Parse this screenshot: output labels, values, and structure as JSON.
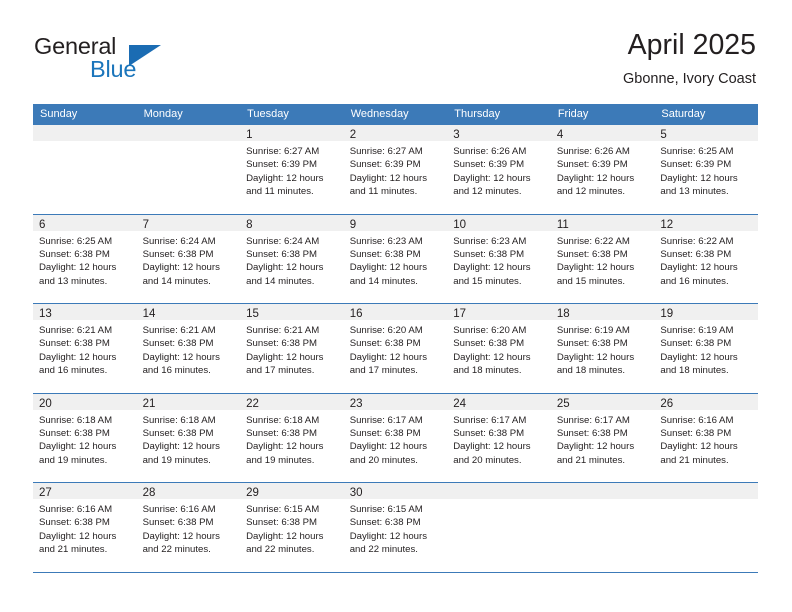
{
  "brand": {
    "name_top": "General",
    "name_bottom": "Blue",
    "triangle_color": "#1b6cb3",
    "blue_color": "#1b75bb"
  },
  "header": {
    "title": "April 2025",
    "subtitle": "Gbonne, Ivory Coast"
  },
  "theme": {
    "header_blue": "#3c7ab8",
    "daynum_band": "#f0f0f0",
    "text": "#231f20"
  },
  "weekdays": [
    "Sunday",
    "Monday",
    "Tuesday",
    "Wednesday",
    "Thursday",
    "Friday",
    "Saturday"
  ],
  "labels": {
    "sunrise_prefix": "Sunrise:",
    "sunset_prefix": "Sunset:",
    "daylight_prefix": "Daylight:"
  },
  "weeks": [
    [
      {
        "day": "",
        "sunrise": "",
        "sunset": "",
        "daylight_line1": "",
        "daylight_line2": ""
      },
      {
        "day": "",
        "sunrise": "",
        "sunset": "",
        "daylight_line1": "",
        "daylight_line2": ""
      },
      {
        "day": "1",
        "sunrise": "Sunrise: 6:27 AM",
        "sunset": "Sunset: 6:39 PM",
        "daylight_line1": "Daylight: 12 hours",
        "daylight_line2": "and 11 minutes."
      },
      {
        "day": "2",
        "sunrise": "Sunrise: 6:27 AM",
        "sunset": "Sunset: 6:39 PM",
        "daylight_line1": "Daylight: 12 hours",
        "daylight_line2": "and 11 minutes."
      },
      {
        "day": "3",
        "sunrise": "Sunrise: 6:26 AM",
        "sunset": "Sunset: 6:39 PM",
        "daylight_line1": "Daylight: 12 hours",
        "daylight_line2": "and 12 minutes."
      },
      {
        "day": "4",
        "sunrise": "Sunrise: 6:26 AM",
        "sunset": "Sunset: 6:39 PM",
        "daylight_line1": "Daylight: 12 hours",
        "daylight_line2": "and 12 minutes."
      },
      {
        "day": "5",
        "sunrise": "Sunrise: 6:25 AM",
        "sunset": "Sunset: 6:39 PM",
        "daylight_line1": "Daylight: 12 hours",
        "daylight_line2": "and 13 minutes."
      }
    ],
    [
      {
        "day": "6",
        "sunrise": "Sunrise: 6:25 AM",
        "sunset": "Sunset: 6:38 PM",
        "daylight_line1": "Daylight: 12 hours",
        "daylight_line2": "and 13 minutes."
      },
      {
        "day": "7",
        "sunrise": "Sunrise: 6:24 AM",
        "sunset": "Sunset: 6:38 PM",
        "daylight_line1": "Daylight: 12 hours",
        "daylight_line2": "and 14 minutes."
      },
      {
        "day": "8",
        "sunrise": "Sunrise: 6:24 AM",
        "sunset": "Sunset: 6:38 PM",
        "daylight_line1": "Daylight: 12 hours",
        "daylight_line2": "and 14 minutes."
      },
      {
        "day": "9",
        "sunrise": "Sunrise: 6:23 AM",
        "sunset": "Sunset: 6:38 PM",
        "daylight_line1": "Daylight: 12 hours",
        "daylight_line2": "and 14 minutes."
      },
      {
        "day": "10",
        "sunrise": "Sunrise: 6:23 AM",
        "sunset": "Sunset: 6:38 PM",
        "daylight_line1": "Daylight: 12 hours",
        "daylight_line2": "and 15 minutes."
      },
      {
        "day": "11",
        "sunrise": "Sunrise: 6:22 AM",
        "sunset": "Sunset: 6:38 PM",
        "daylight_line1": "Daylight: 12 hours",
        "daylight_line2": "and 15 minutes."
      },
      {
        "day": "12",
        "sunrise": "Sunrise: 6:22 AM",
        "sunset": "Sunset: 6:38 PM",
        "daylight_line1": "Daylight: 12 hours",
        "daylight_line2": "and 16 minutes."
      }
    ],
    [
      {
        "day": "13",
        "sunrise": "Sunrise: 6:21 AM",
        "sunset": "Sunset: 6:38 PM",
        "daylight_line1": "Daylight: 12 hours",
        "daylight_line2": "and 16 minutes."
      },
      {
        "day": "14",
        "sunrise": "Sunrise: 6:21 AM",
        "sunset": "Sunset: 6:38 PM",
        "daylight_line1": "Daylight: 12 hours",
        "daylight_line2": "and 16 minutes."
      },
      {
        "day": "15",
        "sunrise": "Sunrise: 6:21 AM",
        "sunset": "Sunset: 6:38 PM",
        "daylight_line1": "Daylight: 12 hours",
        "daylight_line2": "and 17 minutes."
      },
      {
        "day": "16",
        "sunrise": "Sunrise: 6:20 AM",
        "sunset": "Sunset: 6:38 PM",
        "daylight_line1": "Daylight: 12 hours",
        "daylight_line2": "and 17 minutes."
      },
      {
        "day": "17",
        "sunrise": "Sunrise: 6:20 AM",
        "sunset": "Sunset: 6:38 PM",
        "daylight_line1": "Daylight: 12 hours",
        "daylight_line2": "and 18 minutes."
      },
      {
        "day": "18",
        "sunrise": "Sunrise: 6:19 AM",
        "sunset": "Sunset: 6:38 PM",
        "daylight_line1": "Daylight: 12 hours",
        "daylight_line2": "and 18 minutes."
      },
      {
        "day": "19",
        "sunrise": "Sunrise: 6:19 AM",
        "sunset": "Sunset: 6:38 PM",
        "daylight_line1": "Daylight: 12 hours",
        "daylight_line2": "and 18 minutes."
      }
    ],
    [
      {
        "day": "20",
        "sunrise": "Sunrise: 6:18 AM",
        "sunset": "Sunset: 6:38 PM",
        "daylight_line1": "Daylight: 12 hours",
        "daylight_line2": "and 19 minutes."
      },
      {
        "day": "21",
        "sunrise": "Sunrise: 6:18 AM",
        "sunset": "Sunset: 6:38 PM",
        "daylight_line1": "Daylight: 12 hours",
        "daylight_line2": "and 19 minutes."
      },
      {
        "day": "22",
        "sunrise": "Sunrise: 6:18 AM",
        "sunset": "Sunset: 6:38 PM",
        "daylight_line1": "Daylight: 12 hours",
        "daylight_line2": "and 19 minutes."
      },
      {
        "day": "23",
        "sunrise": "Sunrise: 6:17 AM",
        "sunset": "Sunset: 6:38 PM",
        "daylight_line1": "Daylight: 12 hours",
        "daylight_line2": "and 20 minutes."
      },
      {
        "day": "24",
        "sunrise": "Sunrise: 6:17 AM",
        "sunset": "Sunset: 6:38 PM",
        "daylight_line1": "Daylight: 12 hours",
        "daylight_line2": "and 20 minutes."
      },
      {
        "day": "25",
        "sunrise": "Sunrise: 6:17 AM",
        "sunset": "Sunset: 6:38 PM",
        "daylight_line1": "Daylight: 12 hours",
        "daylight_line2": "and 21 minutes."
      },
      {
        "day": "26",
        "sunrise": "Sunrise: 6:16 AM",
        "sunset": "Sunset: 6:38 PM",
        "daylight_line1": "Daylight: 12 hours",
        "daylight_line2": "and 21 minutes."
      }
    ],
    [
      {
        "day": "27",
        "sunrise": "Sunrise: 6:16 AM",
        "sunset": "Sunset: 6:38 PM",
        "daylight_line1": "Daylight: 12 hours",
        "daylight_line2": "and 21 minutes."
      },
      {
        "day": "28",
        "sunrise": "Sunrise: 6:16 AM",
        "sunset": "Sunset: 6:38 PM",
        "daylight_line1": "Daylight: 12 hours",
        "daylight_line2": "and 22 minutes."
      },
      {
        "day": "29",
        "sunrise": "Sunrise: 6:15 AM",
        "sunset": "Sunset: 6:38 PM",
        "daylight_line1": "Daylight: 12 hours",
        "daylight_line2": "and 22 minutes."
      },
      {
        "day": "30",
        "sunrise": "Sunrise: 6:15 AM",
        "sunset": "Sunset: 6:38 PM",
        "daylight_line1": "Daylight: 12 hours",
        "daylight_line2": "and 22 minutes."
      },
      {
        "day": "",
        "sunrise": "",
        "sunset": "",
        "daylight_line1": "",
        "daylight_line2": ""
      },
      {
        "day": "",
        "sunrise": "",
        "sunset": "",
        "daylight_line1": "",
        "daylight_line2": ""
      },
      {
        "day": "",
        "sunrise": "",
        "sunset": "",
        "daylight_line1": "",
        "daylight_line2": ""
      }
    ]
  ]
}
